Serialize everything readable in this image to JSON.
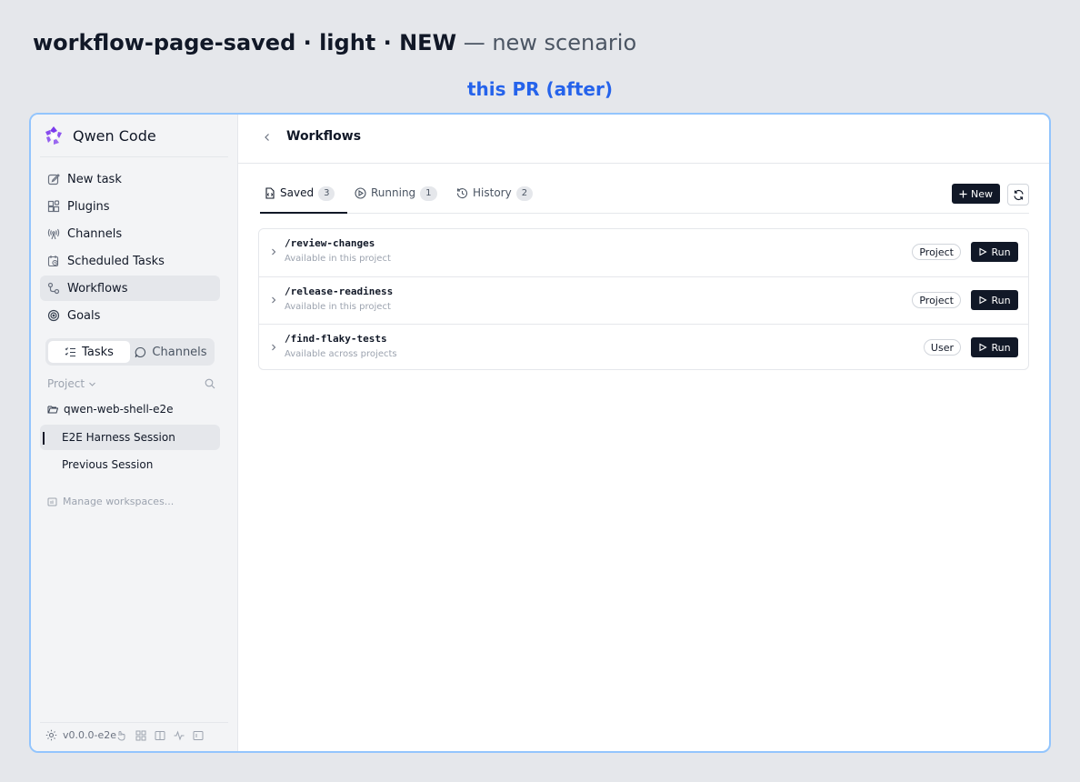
{
  "page": {
    "heading_bold": "workflow-page-saved · light · NEW",
    "heading_sub": "— new scenario",
    "caption": "this PR (after)"
  },
  "colors": {
    "accent": "#2563eb",
    "frame_border": "#93c5fd",
    "button_dark": "#111827",
    "sidebar_bg": "#f3f4f6",
    "logo": "#7c3aed"
  },
  "sidebar": {
    "brand": "Qwen Code",
    "nav": [
      {
        "label": "New task",
        "icon": "edit-icon"
      },
      {
        "label": "Plugins",
        "icon": "plugins-icon"
      },
      {
        "label": "Channels",
        "icon": "broadcast-icon"
      },
      {
        "label": "Scheduled Tasks",
        "icon": "calendar-clock-icon"
      },
      {
        "label": "Workflows",
        "icon": "workflow-icon",
        "active": true
      },
      {
        "label": "Goals",
        "icon": "target-icon"
      }
    ],
    "segments": {
      "tasks": "Tasks",
      "channels": "Channels",
      "selected": "Tasks"
    },
    "project_label": "Project",
    "folder": "qwen-web-shell-e2e",
    "sessions": [
      {
        "label": "E2E Harness Session",
        "active": true
      },
      {
        "label": "Previous Session"
      }
    ],
    "manage": "Manage workspaces...",
    "version": "v0.0.0-e2e"
  },
  "main": {
    "title": "Workflows",
    "tabs": [
      {
        "label": "Saved",
        "count": "3",
        "icon": "file-code-icon"
      },
      {
        "label": "Running",
        "count": "1",
        "icon": "play-circle-icon"
      },
      {
        "label": "History",
        "count": "2",
        "icon": "history-icon"
      }
    ],
    "selected_tab": "Saved",
    "new_button": "New",
    "run_label": "Run",
    "workflows": [
      {
        "name": "/review-changes",
        "desc": "Available in this project",
        "scope": "Project"
      },
      {
        "name": "/release-readiness",
        "desc": "Available in this project",
        "scope": "Project"
      },
      {
        "name": "/find-flaky-tests",
        "desc": "Available across projects",
        "scope": "User"
      }
    ]
  }
}
